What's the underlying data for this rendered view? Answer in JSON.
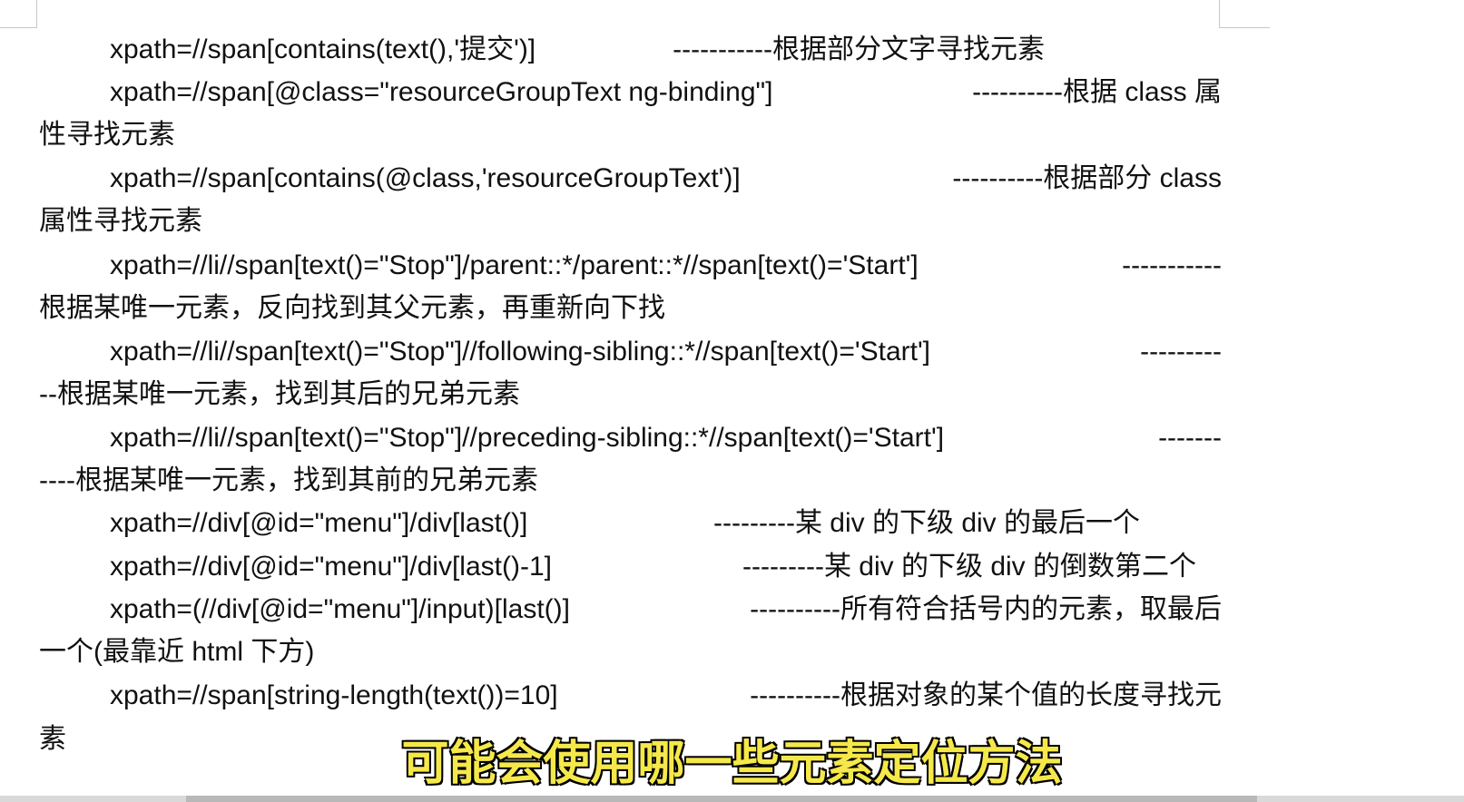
{
  "document": {
    "lines": [
      {
        "code": "xpath=//span[contains(text(),'提交')]",
        "desc": "-----------根据部分文字寻找元素",
        "wrap": ""
      },
      {
        "code": "xpath=//span[@class=\"resourceGroupText ng-binding\"]",
        "desc": "----------根据  class 属",
        "wrap": "性寻找元素"
      },
      {
        "code": "xpath=//span[contains(@class,'resourceGroupText')]",
        "desc": "----------根据部分  class",
        "wrap": "属性寻找元素"
      },
      {
        "code": "xpath=//li//span[text()=\"Stop\"]/parent::*/parent::*//span[text()='Start']",
        "desc": "-----------",
        "wrap": "根据某唯一元素，反向找到其父元素，再重新向下找"
      },
      {
        "code": "xpath=//li//span[text()=\"Stop\"]//following-sibling::*//span[text()='Start']",
        "desc": "---------",
        "wrap": "--根据某唯一元素，找到其后的兄弟元素"
      },
      {
        "code": "xpath=//li//span[text()=\"Stop\"]//preceding-sibling::*//span[text()='Start']",
        "desc": "-------",
        "wrap": "----根据某唯一元素，找到其前的兄弟元素"
      },
      {
        "code": "xpath=//div[@id=\"menu\"]/div[last()]",
        "desc": "---------某  div 的下级  div 的最后一个",
        "wrap": ""
      },
      {
        "code": "xpath=//div[@id=\"menu\"]/div[last()-1]",
        "desc": "---------某  div 的下级  div 的倒数第二个",
        "wrap": ""
      },
      {
        "code": "xpath=(//div[@id=\"menu\"]/input)[last()]",
        "desc": "----------所有符合括号内的元素，取最后",
        "wrap": "一个(最靠近  html 下方)"
      },
      {
        "code": "xpath=//span[string-length(text())=10]",
        "desc": "----------根据对象的某个值的长度寻找元",
        "wrap": "素"
      }
    ]
  },
  "subtitle": "可能会使用哪一些元素定位方法"
}
